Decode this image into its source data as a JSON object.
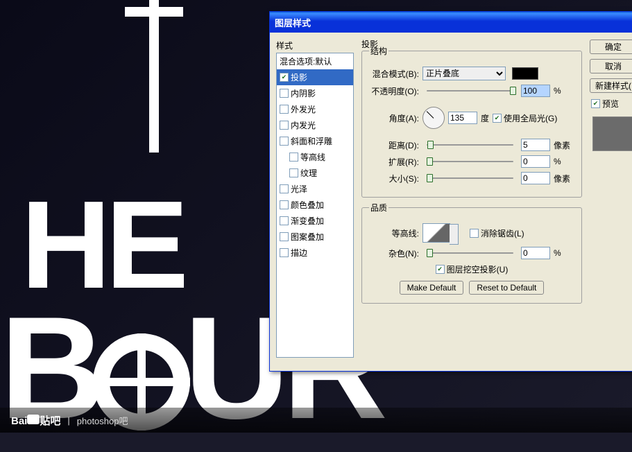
{
  "dialog": {
    "title": "图层样式"
  },
  "styles": {
    "caption": "样式",
    "items": [
      {
        "label": "混合选项:默认",
        "header": true
      },
      {
        "label": "投影",
        "checked": true,
        "selected": true
      },
      {
        "label": "内阴影",
        "checked": false
      },
      {
        "label": "外发光",
        "checked": false
      },
      {
        "label": "内发光",
        "checked": false
      },
      {
        "label": "斜面和浮雕",
        "checked": false
      },
      {
        "label": "等高线",
        "checked": false,
        "level": 2
      },
      {
        "label": "纹理",
        "checked": false,
        "level": 2
      },
      {
        "label": "光泽",
        "checked": false
      },
      {
        "label": "颜色叠加",
        "checked": false
      },
      {
        "label": "渐变叠加",
        "checked": false
      },
      {
        "label": "图案叠加",
        "checked": false
      },
      {
        "label": "描边",
        "checked": false
      }
    ]
  },
  "drop_shadow": {
    "section": "投影",
    "structure_legend": "结构",
    "blend_label": "混合模式(B):",
    "blend_value": "正片叠底",
    "opacity_label": "不透明度(O):",
    "opacity_value": "100",
    "opacity_unit": "%",
    "angle_label": "角度(A):",
    "angle_value": "135",
    "angle_unit": "度",
    "global_light_label": "使用全局光(G)",
    "global_light_checked": true,
    "distance_label": "距离(D):",
    "distance_value": "5",
    "distance_unit": "像素",
    "spread_label": "扩展(R):",
    "spread_value": "0",
    "spread_unit": "%",
    "size_label": "大小(S):",
    "size_value": "0",
    "size_unit": "像素",
    "quality_legend": "品质",
    "contour_label": "等高线:",
    "antialias_label": "消除锯齿(L)",
    "antialias_checked": false,
    "noise_label": "杂色(N):",
    "noise_value": "0",
    "noise_unit": "%",
    "knockout_label": "图层挖空投影(U)",
    "knockout_checked": true,
    "make_default": "Make Default",
    "reset_default": "Reset to Default"
  },
  "right": {
    "ok": "确定",
    "cancel": "取消",
    "new_style": "新建样式(",
    "preview": "预览"
  },
  "watermark": {
    "brand": "Bai",
    "tail": "贴吧",
    "sep": "|",
    "text": "photoshop吧"
  }
}
